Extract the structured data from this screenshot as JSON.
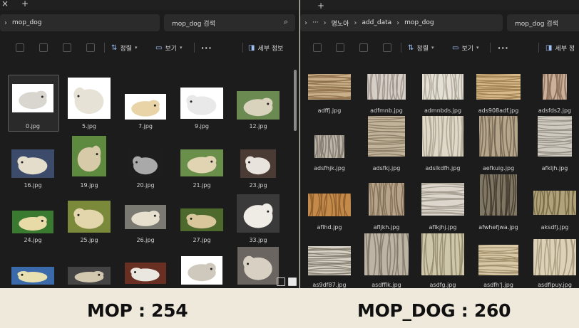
{
  "left": {
    "new_tab_glyph": "+",
    "close_glyph": "×",
    "breadcrumb": [
      "mop_dog"
    ],
    "search_placeholder": "mop_dog 검색",
    "toolbar": {
      "sort": "정렬",
      "view": "보기",
      "more": "···",
      "details": "세부 정보"
    },
    "files": [
      "0.jpg",
      "5.jpg",
      "7.jpg",
      "9.jpg",
      "12.jpg",
      "16.jpg",
      "19.jpg",
      "20.jpg",
      "21.jpg",
      "23.jpg",
      "24.jpg",
      "25.jpg",
      "26.jpg",
      "27.jpg",
      "33.jpg",
      "",
      "",
      "",
      "",
      ""
    ]
  },
  "right": {
    "new_tab_glyph": "+",
    "more_path": "···",
    "breadcrumb": [
      "명노아",
      "add_data",
      "mop_dog"
    ],
    "search_placeholder": "mop_dog 검색",
    "toolbar": {
      "sort": "정렬",
      "view": "보기",
      "more": "···",
      "details": "세부 정"
    },
    "files": [
      "adffj.jpg",
      "adfmnb.jpg",
      "admnbds.jpg",
      "ads908adf.jpg",
      "adsfds2.jpg",
      "adsfhjk.jpg",
      "adsfkj.jpg",
      "adslkdfh.jpg",
      "aefkuig.jpg",
      "afkljh.jpg",
      "aflhd.jpg",
      "afljkh.jpg",
      "aflkjhj.jpg",
      "afwhefjwa.jpg",
      "aksdfj.jpg",
      "as9df87.jpg",
      "asdfflk.jpg",
      "asdfg.jpg",
      "asdfh'|.jpg",
      "asdfipuy.jpg"
    ]
  },
  "captions": {
    "left": "MOP : 254",
    "right": "MOP_DOG : 260"
  },
  "colors": {
    "window_bg": "#1c1c1c",
    "caption_bg": "#efe9dc",
    "accent": "#9fbff5"
  }
}
